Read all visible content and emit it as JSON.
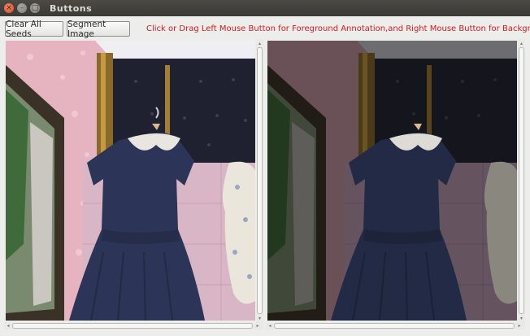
{
  "window": {
    "title": "Buttons",
    "close_glyph": "×",
    "minimize_glyph": "–",
    "maximize_glyph": "□"
  },
  "toolbar": {
    "clear_label": "Clear All Seeds",
    "segment_label": "Segment Image",
    "instructions": "Click or Drag Left Mouse Button for Foreground Annotation,and Right Mouse Button for Background.",
    "instructions_color": "#d01c1c"
  },
  "panels": {
    "left": {
      "content": "original-photo",
      "icon": "photo-icon"
    },
    "right": {
      "content": "segmentation-preview",
      "icon": "photo-icon"
    }
  },
  "scrollbars": {
    "up_arrow": "▴",
    "down_arrow": "▾",
    "left_arrow": "◂",
    "right_arrow": "▸"
  }
}
